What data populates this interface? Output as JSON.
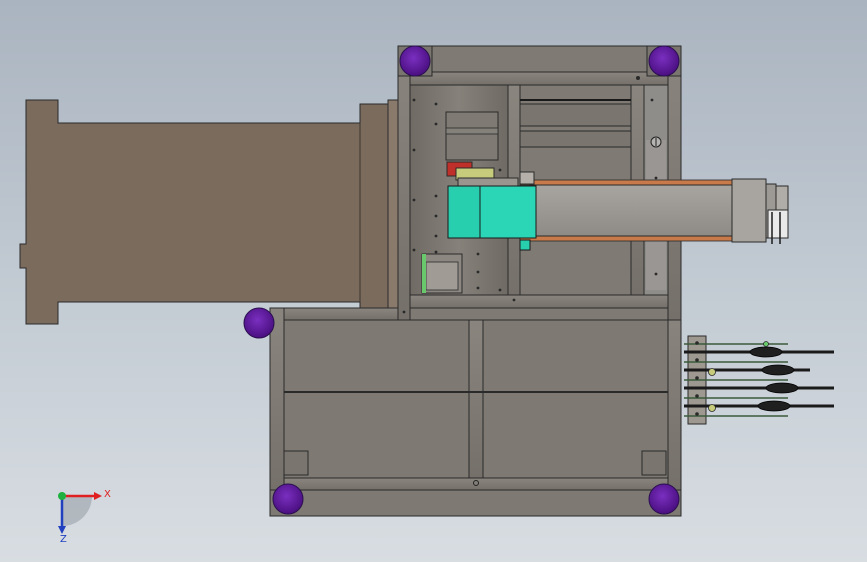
{
  "viewport": {
    "background_top": "#aab4c0",
    "background_bottom": "#d8dde2"
  },
  "colors": {
    "frame_fill": "#7f7a73",
    "frame_stroke": "#2a2a2a",
    "motor_body": "#7b6b5d",
    "leveling_foot": "#5b1596",
    "teal_block": "#28cfae",
    "red_part": "#c0302a",
    "olive_part": "#c7cc7c",
    "green_part": "#69c86b",
    "rail_orange": "#c87a4a",
    "axis_x": "#e02020",
    "axis_y": "#20b040",
    "axis_z": "#2040c0"
  },
  "triad": {
    "x_label": "X",
    "z_label": "Z"
  },
  "components": [
    "motor-housing",
    "upper-frame",
    "lower-base-frame",
    "leveling-feet",
    "linear-slide",
    "slide-carriage",
    "valve-manifold"
  ]
}
